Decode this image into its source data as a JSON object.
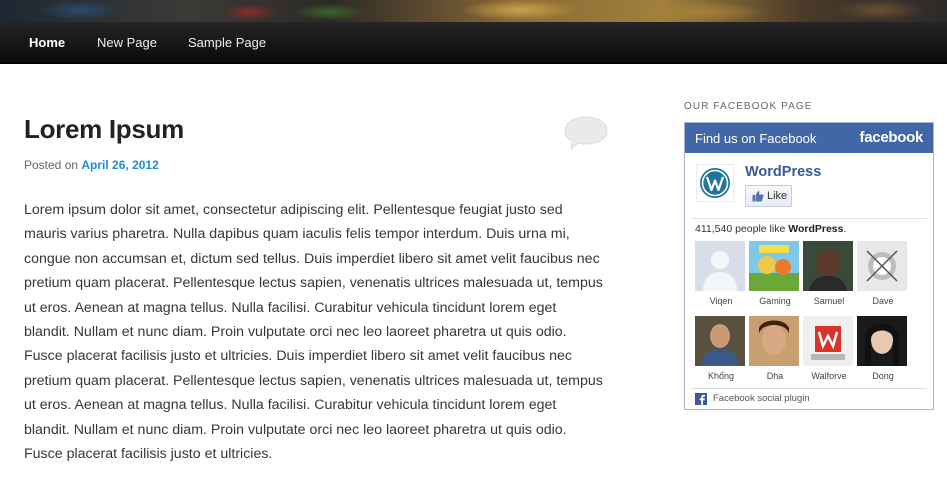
{
  "nav": {
    "items": [
      {
        "label": "Home"
      },
      {
        "label": "New Page"
      },
      {
        "label": "Sample Page"
      }
    ]
  },
  "post": {
    "title": "Lorem Ipsum",
    "meta_prefix": "Posted on",
    "date": "April 26, 2012",
    "content": "Lorem ipsum dolor sit amet, consectetur adipiscing elit. Pellentesque feugiat justo sed mauris varius pharetra. Nulla dapibus quam iaculis felis tempor interdum. Duis urna mi, congue non accumsan et, dictum sed tellus. Duis imperdiet libero sit amet velit faucibus nec pretium quam placerat. Pellentesque lectus sapien, venenatis ultrices malesuada ut, tempus ut eros. Aenean at magna tellus. Nulla facilisi. Curabitur vehicula tincidunt lorem eget blandit. Nullam et nunc diam. Proin vulputate orci nec leo laoreet pharetra ut quis odio. Fusce placerat facilisis justo et ultricies. Duis imperdiet libero sit amet velit faucibus nec pretium quam placerat. Pellentesque lectus sapien, venenatis ultrices malesuada ut, tempus ut eros. Aenean at magna tellus. Nulla facilisi. Curabitur vehicula tincidunt lorem eget blandit. Nullam et nunc diam. Proin vulputate orci nec leo laoreet pharetra ut quis odio. Fusce placerat facilisis justo et ultricies."
  },
  "sidebar": {
    "widget_title": "Our Facebook Page",
    "fb": {
      "header_title": "Find us on Facebook",
      "header_logo": "facebook",
      "page_name": "WordPress",
      "like_label": "Like",
      "count_text": "411,540 people like",
      "count_page": "WordPress",
      "count_suffix": ".",
      "fans": [
        {
          "name": "Viqen"
        },
        {
          "name": "Gaming"
        },
        {
          "name": "Samuel"
        },
        {
          "name": "Dave"
        },
        {
          "name": "Khổng"
        },
        {
          "name": "Dha"
        },
        {
          "name": "Walforve"
        },
        {
          "name": "Dong"
        }
      ],
      "footer": "Facebook social plugin"
    }
  },
  "colors": {
    "link": "#1b8be0",
    "fb_blue": "#4267a6",
    "fb_name": "#3b5998"
  }
}
